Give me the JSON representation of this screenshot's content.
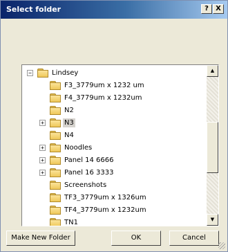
{
  "title": "Select folder",
  "title_buttons": {
    "help": "?",
    "close": "X"
  },
  "tree": [
    {
      "label": "Lindsey",
      "expander": "−"
    },
    {
      "label": "F3_3779um x 1232 um"
    },
    {
      "label": "F4_3779um x 1232um"
    },
    {
      "label": "N2"
    },
    {
      "label": "N3",
      "expander": "+",
      "selected": true
    },
    {
      "label": "N4"
    },
    {
      "label": "Noodles",
      "expander": "+"
    },
    {
      "label": "Panel 14 6666",
      "expander": "+"
    },
    {
      "label": "Panel 16 3333",
      "expander": "+"
    },
    {
      "label": "Screenshots"
    },
    {
      "label": "TF3_3779um x 1326um"
    },
    {
      "label": "TF4_3779um x 1232um"
    },
    {
      "label": "TN1"
    }
  ],
  "scrollbar": {
    "up": "▲",
    "down": "▼"
  },
  "buttons": {
    "new_folder": "Make New Folder",
    "ok": "OK",
    "cancel": "Cancel"
  }
}
